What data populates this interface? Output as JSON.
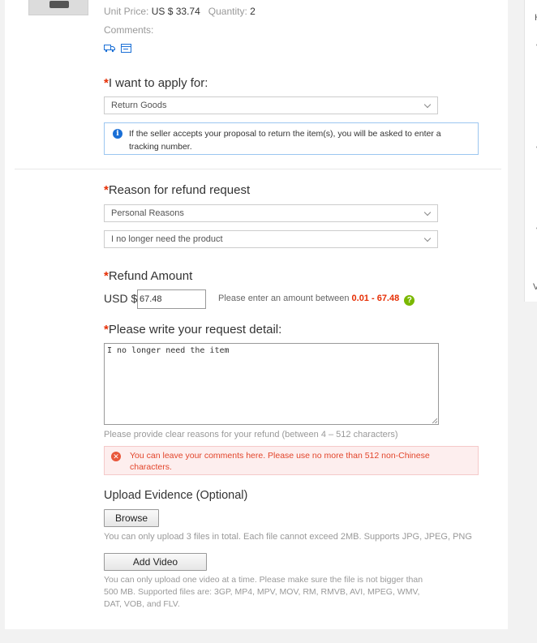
{
  "product": {
    "unit_price_label": "Unit Price:",
    "unit_price_value": "US $ 33.74",
    "quantity_label": "Quantity:",
    "quantity_value": "2",
    "comments_label": "Comments:"
  },
  "apply": {
    "required_mark": "*",
    "label": "I want to apply for:",
    "selected": "Return Goods",
    "info": "If the seller accepts your proposal to return the item(s), you will be asked to enter a tracking number."
  },
  "reason": {
    "required_mark": "*",
    "label": "Reason for refund request",
    "primary_selected": "Personal Reasons",
    "secondary_selected": "I no longer need the product"
  },
  "refund": {
    "required_mark": "*",
    "label": "Refund Amount",
    "currency": "USD $",
    "value": "67.48",
    "hint": "Please enter an amount between",
    "range": "0.01 - 67.48",
    "help": "?"
  },
  "detail": {
    "required_mark": "*",
    "label": "Please write your request detail:",
    "value": "I no longer need the item",
    "hint": "Please provide clear reasons for your refund (between 4 – 512 characters)",
    "error": "You can leave your comments here. Please use no more than 512 non-Chinese characters."
  },
  "evidence": {
    "label": "Upload Evidence (Optional)",
    "browse_label": "Browse",
    "file_note": "You can only upload 3 files in total. Each file cannot exceed 2MB. Supports JPG, JPEG, PNG",
    "add_video_label": "Add Video",
    "video_note": "You can only upload one video at a time. Please make sure the file is not bigger than 500 MB. Supported files are: 3GP, MP4, MPV, MOV, RM, RMVB, AVI, MPEG, WMV, DAT, VOB, and FLV."
  },
  "side": {
    "letter_h": "H",
    "letter_v": "V"
  },
  "colors": {
    "required": "#e62e04",
    "info_border": "#9cc6f0",
    "error_text": "#e2452b",
    "help_icon": "#7ab800"
  },
  "icons": [
    "truck-icon",
    "card-icon",
    "info-icon",
    "chevron-down-icon",
    "help-icon",
    "error-icon",
    "resize-handle-icon"
  ]
}
